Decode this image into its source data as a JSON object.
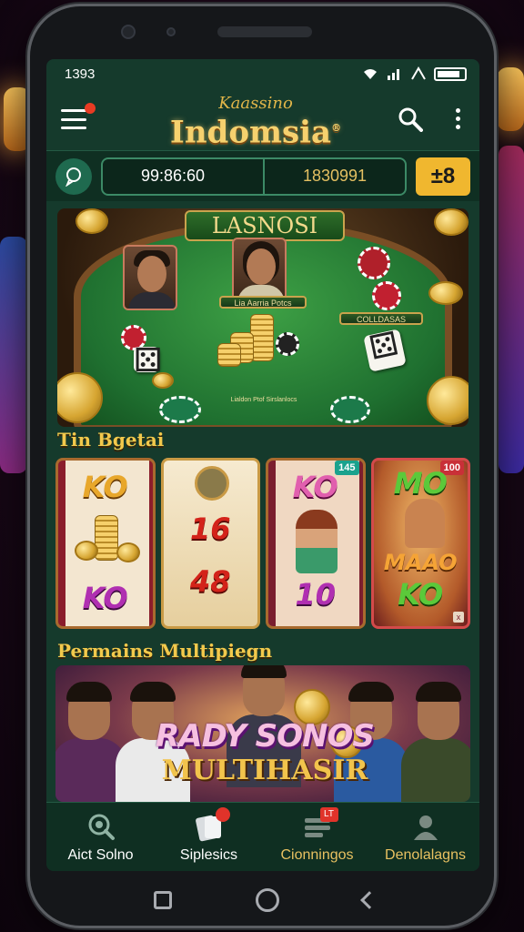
{
  "status": {
    "time": "1393"
  },
  "header": {
    "logo_script": "Kaassino",
    "logo_main": "Indomsia",
    "logo_mark": "®"
  },
  "account": {
    "balance_left": "99:86:60",
    "balance_right": "1830991",
    "badge": "±8"
  },
  "banner": {
    "title": "LASNOSI",
    "plaque_center": "Lia Aarria Potcs",
    "plaque_right": "COLLDASAS",
    "plaque_bottom": "Lialdon Ptof Sirslanlocs"
  },
  "section1": {
    "title": "Tin Bgetai"
  },
  "slots": [
    {
      "top": "KO",
      "bottom": "KO"
    },
    {
      "top": "16",
      "bottom": "48"
    },
    {
      "top": "KO",
      "bottom": "10",
      "badge": "145"
    },
    {
      "top": "MO",
      "middle": "MAAO",
      "bottom": "KO",
      "badge": "100"
    }
  ],
  "section2": {
    "title": "Permains Multipiegn"
  },
  "multiplayer": {
    "line1": "RADY SONOS",
    "line2": "MULTIHASIR"
  },
  "nav": [
    {
      "label": "Aict Solno",
      "icon": "search-icon"
    },
    {
      "label": "Siplesics",
      "icon": "cards-icon",
      "badge": ""
    },
    {
      "label": "Cionningos",
      "icon": "list-icon",
      "badge": "LT"
    },
    {
      "label": "Denolalagns",
      "icon": "user-icon"
    }
  ],
  "colors": {
    "accent": "#f2c94c",
    "screen_bg": "#153a2c",
    "nav_bg": "#0f2f22"
  }
}
